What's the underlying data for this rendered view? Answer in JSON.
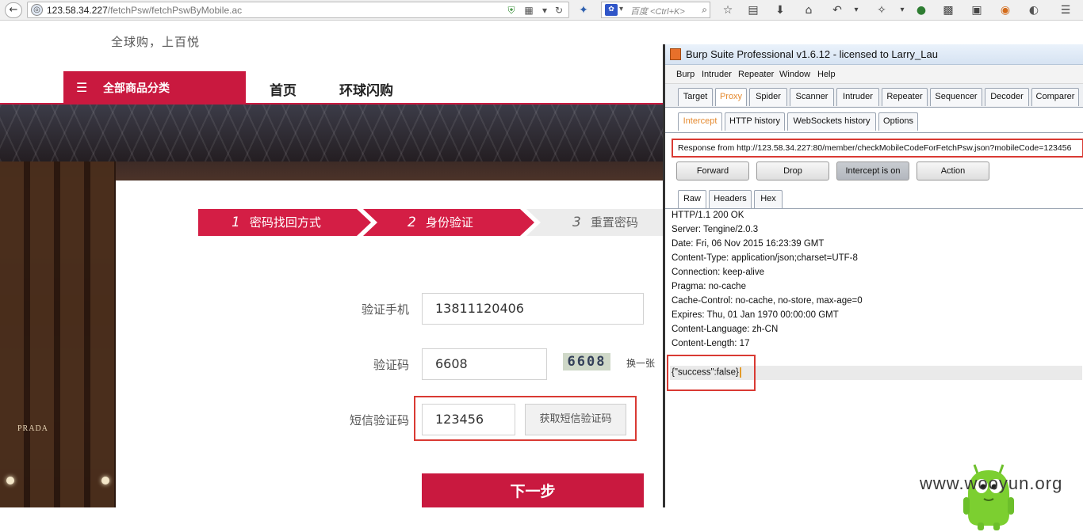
{
  "browser": {
    "url_host": "123.58.34.227",
    "url_path": "/fetchPsw/fetchPswByMobile.ac",
    "search_placeholder": "百度 <Ctrl+K>",
    "search_engine_icon": "paw-icon"
  },
  "site": {
    "slogan": "全球购，上百悦",
    "category_menu_label": "全部商品分类",
    "nav_links": [
      "首页",
      "环球闪购"
    ],
    "banner_sign": "PRADA",
    "steps": [
      {
        "num": "1",
        "label": "密码找回方式"
      },
      {
        "num": "2",
        "label": "身份验证"
      },
      {
        "num": "3",
        "label": "重置密码"
      }
    ],
    "form": {
      "phone_label": "验证手机",
      "phone_value": "13811120406",
      "captcha_label": "验证码",
      "captcha_value": "6608",
      "captcha_image_text": "6608",
      "captcha_refresh": "换一张",
      "sms_label": "短信验证码",
      "sms_value": "123456",
      "sms_button": "获取短信验证码",
      "next_button": "下一步"
    }
  },
  "burp": {
    "title": "Burp Suite Professional v1.6.12 - licensed to Larry_Lau",
    "menu": [
      "Burp",
      "Intruder",
      "Repeater",
      "Window",
      "Help"
    ],
    "tabs": [
      "Target",
      "Proxy",
      "Spider",
      "Scanner",
      "Intruder",
      "Repeater",
      "Sequencer",
      "Decoder",
      "Comparer"
    ],
    "active_tab": "Proxy",
    "proxy_tabs": [
      "Intercept",
      "HTTP history",
      "WebSockets history",
      "Options"
    ],
    "active_proxy_tab": "Intercept",
    "response_from": "Response from http://123.58.34.227:80/member/checkMobileCodeForFetchPsw.json?mobileCode=123456",
    "buttons": {
      "forward": "Forward",
      "drop": "Drop",
      "intercept": "Intercept is on",
      "action": "Action"
    },
    "view_tabs": [
      "Raw",
      "Headers",
      "Hex"
    ],
    "active_view_tab": "Raw",
    "response_lines": [
      "HTTP/1.1 200 OK",
      "Server: Tengine/2.0.3",
      "Date: Fri, 06 Nov 2015 16:23:39 GMT",
      "Content-Type: application/json;charset=UTF-8",
      "Connection: keep-alive",
      "Pragma: no-cache",
      "Cache-Control: no-cache, no-store, max-age=0",
      "Expires: Thu, 01 Jan 1970 00:00:00 GMT",
      "Content-Language: zh-CN",
      "Content-Length: 17"
    ],
    "response_body": "{\"success\":false}",
    "accent_color": "#e58a2f",
    "highlight_color": "#d93a33"
  },
  "watermark": "www.wooyun.org",
  "colors": {
    "brand_red": "#c9193f",
    "step_red": "#d41e45"
  }
}
